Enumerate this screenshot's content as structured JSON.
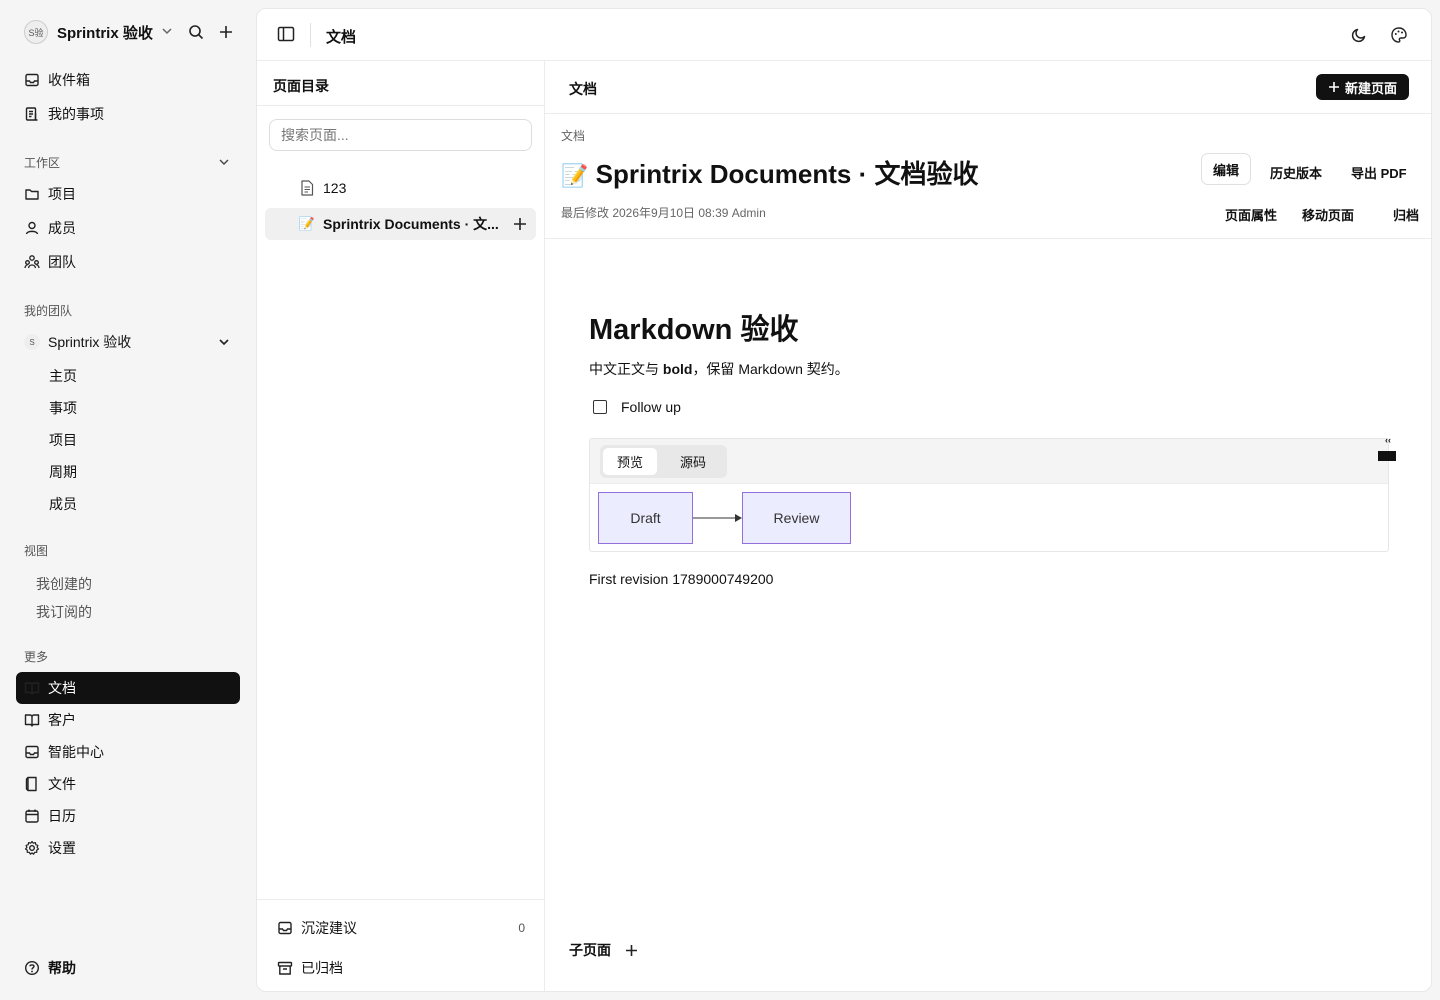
{
  "workspace": {
    "avatar": "S验",
    "name": "Sprintrix 验收"
  },
  "nav_top": [
    {
      "label": "收件箱",
      "icon": "inbox-icon"
    },
    {
      "label": "我的事项",
      "icon": "my-issues-icon"
    }
  ],
  "workspace_section": {
    "label": "工作区",
    "items": [
      {
        "label": "项目",
        "icon": "folder-icon"
      },
      {
        "label": "成员",
        "icon": "user-icon"
      },
      {
        "label": "团队",
        "icon": "team-icon"
      }
    ]
  },
  "teams_section": {
    "label": "我的团队",
    "team": {
      "badge": "S",
      "name": "Sprintrix 验收"
    },
    "items": [
      "主页",
      "事项",
      "项目",
      "周期",
      "成员"
    ]
  },
  "views_section": {
    "label": "视图",
    "items": [
      "我创建的",
      "我订阅的"
    ]
  },
  "more_section": {
    "label": "更多",
    "items": [
      {
        "label": "文档",
        "icon": "book-icon",
        "active": true
      },
      {
        "label": "客户",
        "icon": "book-icon"
      },
      {
        "label": "智能中心",
        "icon": "inbox-icon"
      },
      {
        "label": "文件",
        "icon": "file-icon"
      },
      {
        "label": "日历",
        "icon": "calendar-icon"
      },
      {
        "label": "设置",
        "icon": "gear-icon"
      }
    ]
  },
  "help_label": "帮助",
  "topbar": {
    "title": "文档"
  },
  "tree": {
    "heading": "页面目录",
    "search_placeholder": "搜索页面...",
    "pages": [
      {
        "title": "123",
        "icon": "page-icon"
      },
      {
        "title": "Sprintrix Documents · 文...",
        "icon": "📝"
      }
    ],
    "footer": [
      {
        "label": "沉淀建议",
        "count": "0"
      },
      {
        "label": "已归档"
      }
    ]
  },
  "doc": {
    "header_title": "文档",
    "new_page_label": "新建页面",
    "breadcrumb": "文档",
    "emoji": "📝",
    "title": "Sprintrix Documents · 文档验收",
    "meta": "最后修改 2026年9月10日 08:39 Admin",
    "actions_top": [
      "编辑",
      "历史版本",
      "导出 PDF"
    ],
    "actions_bottom": [
      "页面属性",
      "移动页面",
      "归档"
    ],
    "content": {
      "h1": "Markdown 验收",
      "para_before": "中文正文与 ",
      "para_bold": "bold",
      "para_after": "，保留 Markdown 契约。",
      "task": "Follow up",
      "mermaid_tabs": [
        "预览",
        "源码"
      ],
      "nodes": [
        "Draft",
        "Review"
      ],
      "revision": "First revision 1789000749200"
    },
    "subpages_label": "子页面"
  },
  "colors": {
    "accent": "#111111",
    "node_fill": "#ececff",
    "node_stroke": "#9370db"
  }
}
